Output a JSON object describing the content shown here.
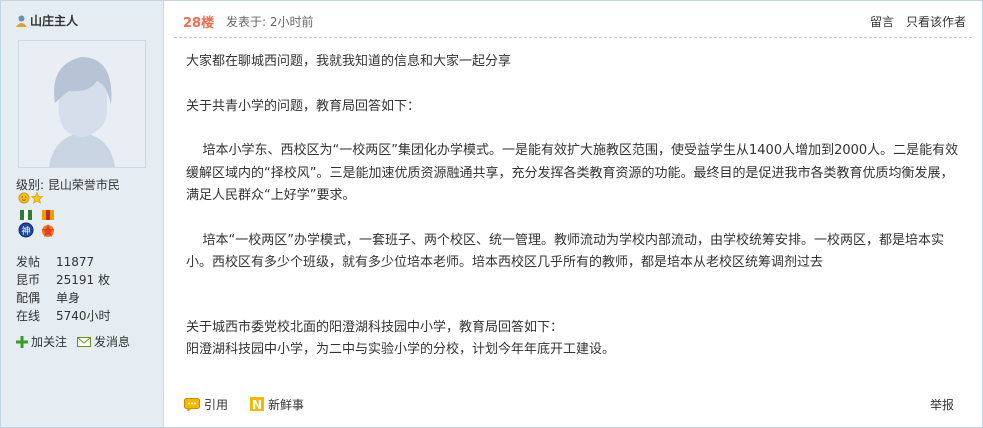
{
  "author": {
    "name": "山庄主人",
    "level_label": "级别: 昆山荣誉市民"
  },
  "stats": [
    {
      "key": "发帖",
      "value": "11877"
    },
    {
      "key": "昆币",
      "value": "25191 枚"
    },
    {
      "key": "配偶",
      "value": "单身"
    },
    {
      "key": "在线",
      "value": "5740小时"
    }
  ],
  "actions": {
    "follow": "加关注",
    "message": "发消息"
  },
  "post": {
    "floor": "28楼",
    "posted": "发表于: 2小时前",
    "reply_link": "留言",
    "only_author": "只看该作者",
    "paragraphs": [
      "大家都在聊城西问题，我就我知道的信息和大家一起分享",
      "关于共青小学的问题，教育局回答如下：",
      "    培本小学东、西校区为“一校两区”集团化办学模式。一是能有效扩大施教区范围，使受益学生从1400人增加到2000人。二是能有效缓解区域内的“择校风”。三是能加速优质资源融通共享，充分发挥各类教育资源的功能。最终目的是促进我市各类教育优质均衡发展，满足人民群众“上好学”要求。",
      "    培本“一校两区”办学模式，一套班子、两个校区、统一管理。教师流动为学校内部流动，由学校统筹安排。一校两区，都是培本实小。西校区有多少个班级，就有多少位培本老师。培本西校区几乎所有的教师，都是培本从老校区统筹调剂过去",
      "关于城西市委党校北面的阳澄湖科技园中小学，教育局回答如下：",
      "阳澄湖科技园中小学，为二中与实验小学的分校，计划今年年底开工建设。"
    ],
    "quote_label": "引用",
    "fresh_label": "新鲜事",
    "report_label": "举报"
  },
  "colors": {
    "floor": "#f26c4f",
    "sidebar_bg": "#e5edf2",
    "border": "#c2d5e3"
  }
}
